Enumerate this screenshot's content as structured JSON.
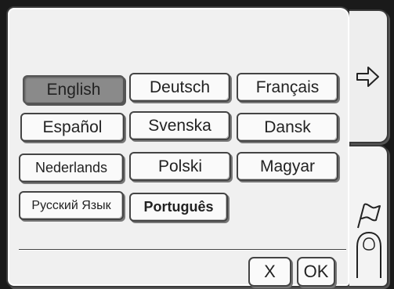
{
  "languages": [
    {
      "label": "English",
      "selected": true
    },
    {
      "label": "Deutsch",
      "selected": false
    },
    {
      "label": "Français",
      "selected": false
    },
    {
      "label": "Español",
      "selected": false
    },
    {
      "label": "Svenska",
      "selected": false
    },
    {
      "label": "Dansk",
      "selected": false
    },
    {
      "label": "Nederlands",
      "selected": false
    },
    {
      "label": "Polski",
      "selected": false
    },
    {
      "label": "Magyar",
      "selected": false
    },
    {
      "label": "Русский Язык",
      "selected": false
    },
    {
      "label": "Português",
      "selected": false
    }
  ],
  "actions": {
    "cancel_label": "X",
    "ok_label": "OK"
  },
  "icons": {
    "next_tab": "arrow-right-icon",
    "language_tab": "flag-icon",
    "touch_hint": "finger-icon"
  }
}
